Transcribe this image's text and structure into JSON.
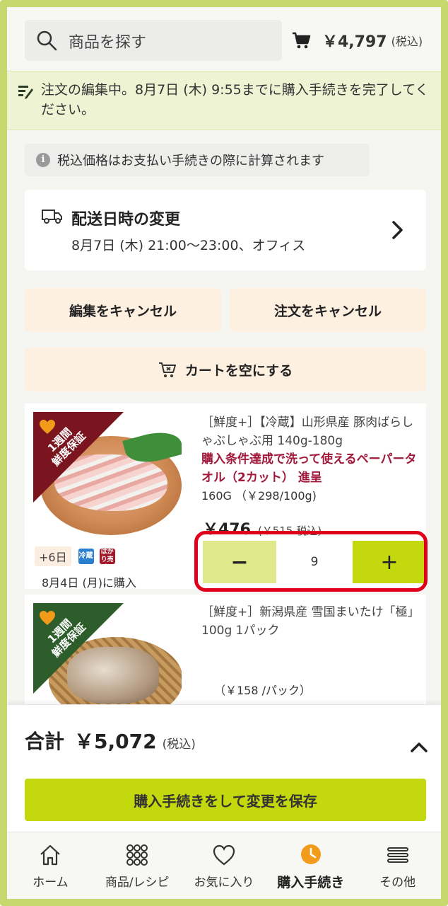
{
  "header": {
    "search_placeholder": "商品を探す",
    "cart_total": "￥4,797",
    "cart_tax_note": "(税込)"
  },
  "banner": {
    "text": "注文の編集中。8月7日 (木) 9:55までに購入手続きを完了してください。"
  },
  "tax_note": "税込価格はお支払い手続きの際に計算されます",
  "delivery": {
    "title": "配送日時の変更",
    "detail": "8月7日 (木) 21:00〜23:00、オフィス"
  },
  "actions": {
    "cancel_edit": "編集をキャンセル",
    "cancel_order": "注文をキャンセル",
    "empty_cart": "カートを空にする"
  },
  "items": [
    {
      "ribbon": "1週間\n鮮度保証",
      "name": "［鮮度+］【冷蔵】山形県産 豚肉ばらしゃぶしゃぶ用 140g-180g",
      "promo": "購入条件達成で洗って使えるペーパータオル（2カット） 進呈",
      "unit": "160G （￥298/100g)",
      "price": "￥476",
      "price_tax": "(￥515 税込)",
      "days": "+6日",
      "tag_chill": "冷蔵",
      "tag_weigh": "はかり売り",
      "bought": "8月4日 (月)に購入",
      "quantity": "9",
      "minus": "−",
      "plus": "+"
    },
    {
      "ribbon": "1週間\n鮮度保証",
      "name": "［鮮度+］新潟県産 雪国まいたけ「極」100g 1パック",
      "unit_price": "（￥158 /パック）"
    }
  ],
  "total": {
    "label": "合計",
    "amount": "￥5,072",
    "tax": "(税込)",
    "checkout": "購入手続きをして変更を保存"
  },
  "nav": [
    {
      "label": "ホーム",
      "icon": "home-icon"
    },
    {
      "label": "商品/レシピ",
      "icon": "grid-icon"
    },
    {
      "label": "お気に入り",
      "icon": "heart-icon"
    },
    {
      "label": "購入手続き",
      "icon": "clock-icon",
      "active": true
    },
    {
      "label": "その他",
      "icon": "menu-icon"
    }
  ],
  "colors": {
    "accent": "#c3d80d",
    "accent_light": "#dfe98a",
    "promo": "#a0183a",
    "highlight": "#e0001b"
  }
}
